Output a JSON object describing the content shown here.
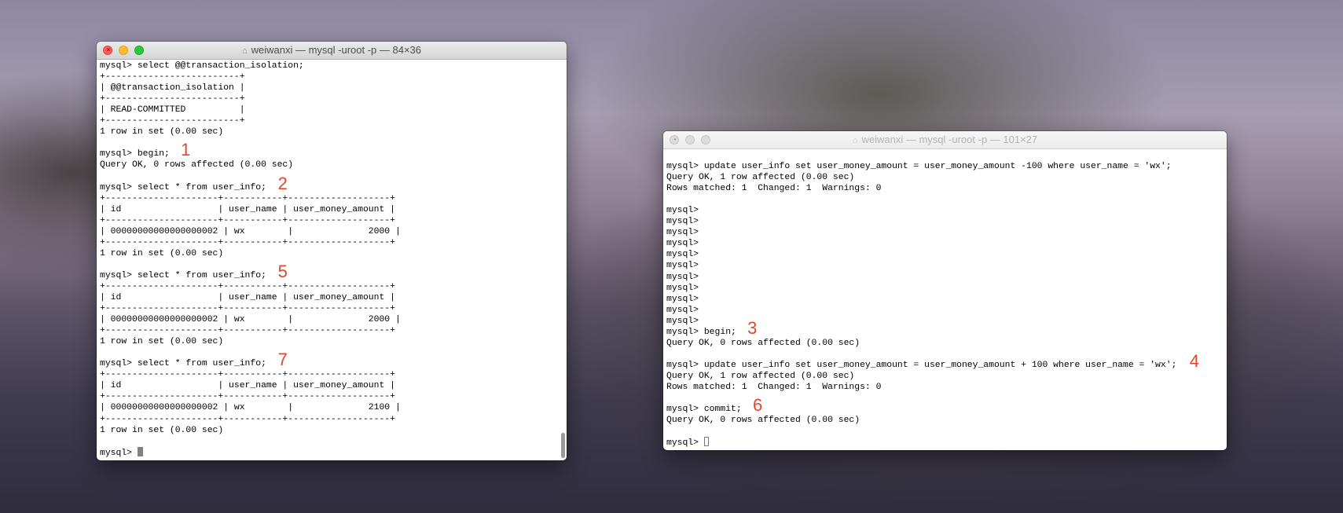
{
  "windows": {
    "left": {
      "title": "weiwanxi — mysql -uroot -p — 84×36",
      "lines": [
        "mysql> select @@transaction_isolation;",
        "+-------------------------+",
        "| @@transaction_isolation |",
        "+-------------------------+",
        "| READ-COMMITTED          |",
        "+-------------------------+",
        "1 row in set (0.00 sec)",
        "",
        "mysql> begin;",
        "Query OK, 0 rows affected (0.00 sec)",
        "",
        "mysql> select * from user_info;",
        "+---------------------+-----------+-------------------+",
        "| id                  | user_name | user_money_amount |",
        "+---------------------+-----------+-------------------+",
        "| 00000000000000000002 | wx        |              2000 |",
        "+---------------------+-----------+-------------------+",
        "1 row in set (0.00 sec)",
        "",
        "mysql> select * from user_info;",
        "+---------------------+-----------+-------------------+",
        "| id                  | user_name | user_money_amount |",
        "+---------------------+-----------+-------------------+",
        "| 00000000000000000002 | wx        |              2000 |",
        "+---------------------+-----------+-------------------+",
        "1 row in set (0.00 sec)",
        "",
        "mysql> select * from user_info;",
        "+---------------------+-----------+-------------------+",
        "| id                  | user_name | user_money_amount |",
        "+---------------------+-----------+-------------------+",
        "| 00000000000000000002 | wx        |              2100 |",
        "+---------------------+-----------+-------------------+",
        "1 row in set (0.00 sec)",
        "",
        "mysql> "
      ],
      "annotations": [
        {
          "label": "1",
          "line": 8
        },
        {
          "label": "2",
          "line": 11
        },
        {
          "label": "5",
          "line": 19
        },
        {
          "label": "7",
          "line": 27
        }
      ]
    },
    "right": {
      "title": "weiwanxi — mysql -uroot -p — 101×27",
      "lines": [
        "",
        "mysql> update user_info set user_money_amount = user_money_amount -100 where user_name = 'wx';",
        "Query OK, 1 row affected (0.00 sec)",
        "Rows matched: 1  Changed: 1  Warnings: 0",
        "",
        "mysql>",
        "mysql>",
        "mysql>",
        "mysql>",
        "mysql>",
        "mysql>",
        "mysql>",
        "mysql>",
        "mysql>",
        "mysql>",
        "mysql>",
        "mysql> begin;",
        "Query OK, 0 rows affected (0.00 sec)",
        "",
        "mysql> update user_info set user_money_amount = user_money_amount + 100 where user_name = 'wx';",
        "Query OK, 1 row affected (0.00 sec)",
        "Rows matched: 1  Changed: 1  Warnings: 0",
        "",
        "mysql> commit;",
        "Query OK, 0 rows affected (0.00 sec)",
        "",
        "mysql> "
      ],
      "annotations": [
        {
          "label": "3",
          "line": 16
        },
        {
          "label": "4",
          "line": 19
        },
        {
          "label": "6",
          "line": 23
        }
      ]
    }
  },
  "colors": {
    "annotation": "#e0482e",
    "close": "#fe5f57",
    "minimize": "#febc2e",
    "maximize": "#28c840"
  },
  "icons": [
    "home-icon",
    "close-icon"
  ]
}
